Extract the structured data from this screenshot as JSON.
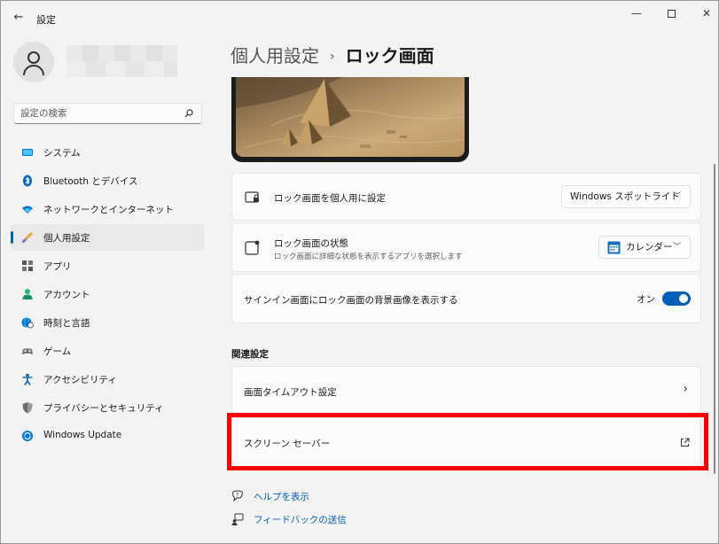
{
  "window": {
    "title": "設定",
    "back_icon": "←",
    "minimize_icon": "—",
    "close_icon": "✕"
  },
  "search": {
    "placeholder": "設定の検索"
  },
  "sidebar": {
    "items": [
      {
        "label": "システム",
        "icon": "monitor-icon",
        "active": false
      },
      {
        "label": "Bluetooth とデバイス",
        "icon": "bluetooth-icon",
        "active": false
      },
      {
        "label": "ネットワークとインターネット",
        "icon": "wifi-icon",
        "active": false
      },
      {
        "label": "個人用設定",
        "icon": "brush-icon",
        "active": true
      },
      {
        "label": "アプリ",
        "icon": "apps-icon",
        "active": false
      },
      {
        "label": "アカウント",
        "icon": "person-icon",
        "active": false
      },
      {
        "label": "時刻と言語",
        "icon": "globe-clock-icon",
        "active": false
      },
      {
        "label": "ゲーム",
        "icon": "gamepad-icon",
        "active": false
      },
      {
        "label": "アクセシビリティ",
        "icon": "accessibility-icon",
        "active": false
      },
      {
        "label": "プライバシーとセキュリティ",
        "icon": "shield-icon",
        "active": false
      },
      {
        "label": "Windows Update",
        "icon": "update-icon",
        "active": false
      }
    ]
  },
  "header": {
    "parent": "個人用設定",
    "separator": "›",
    "current": "ロック画面"
  },
  "settings": {
    "personalize": {
      "title": "ロック画面を個人用に設定",
      "value": "Windows スポットライト"
    },
    "status": {
      "title": "ロック画面の状態",
      "subtitle": "ロック画面に詳細な状態を表示するアプリを選択します",
      "value": "カレンダー"
    },
    "signin_bg": {
      "title": "サインイン画面にロック画面の背景画像を表示する",
      "toggle_label": "オン",
      "toggle_on": true
    }
  },
  "related": {
    "title": "関連設定",
    "timeout": "画面タイムアウト設定",
    "screensaver": "スクリーン セーバー",
    "chevron": "›",
    "external_icon": "↗"
  },
  "links": {
    "help": "ヘルプを表示",
    "feedback": "フィードバックの送信"
  },
  "colors": {
    "accent": "#005fb8",
    "highlight": "#ff0000"
  }
}
